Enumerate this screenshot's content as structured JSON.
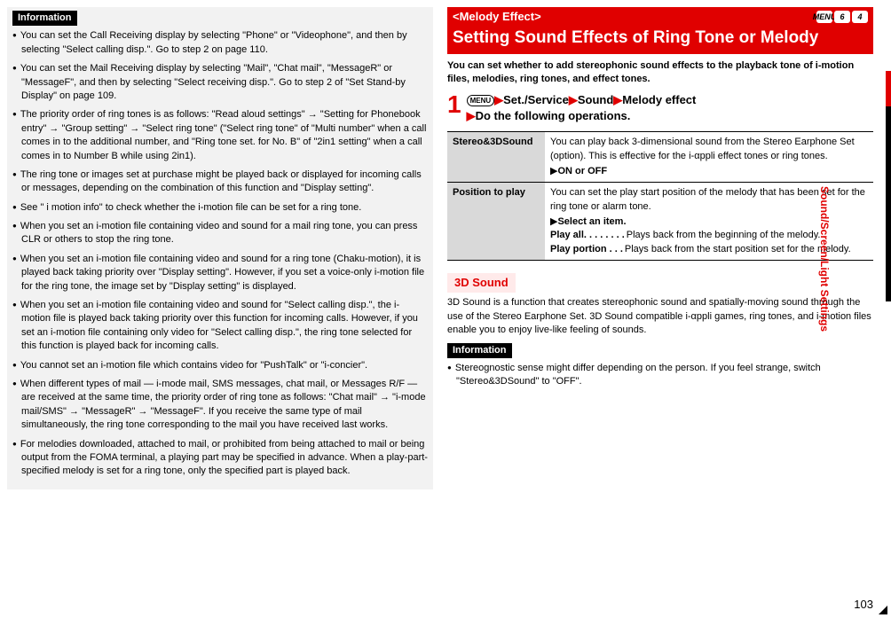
{
  "left": {
    "info_header": "Information",
    "bullets": [
      "You can set the Call Receiving display by selecting \"Phone\" or \"Videophone\", and then by selecting \"Select calling disp.\". Go to step 2 on page 110.",
      "You can set the Mail Receiving display by selecting \"Mail\", \"Chat mail\", \"MessageR\" or \"MessageF\", and then by selecting \"Select receiving disp.\". Go to step 2 of \"Set Stand-by Display\" on page 109.",
      "The priority order of ring tones is as follows: \"Read aloud settings\" → \"Setting for Phonebook entry\" → \"Group setting\" → \"Select ring tone\" (\"Select ring tone\" of \"Multi number\" when a call comes in to the additional number, and \"Ring tone set. for No. B\" of \"2in1 setting\" when a call comes in to Number B while using 2in1).",
      "The ring tone or images set at purchase might be played back or displayed for incoming calls or messages, depending on the combination of this function and \"Display setting\".",
      "See \" i motion info\" to check whether the i-motion file can be set for a ring tone.",
      "When you set an i-motion file containing video and sound for a mail ring tone, you can press CLR or others to stop the ring tone.",
      "When you set an i-motion file containing video and sound for a ring tone (Chaku-motion), it is played back taking priority over \"Display setting\". However, if you set a voice-only i-motion file for the ring tone, the image set by \"Display setting\" is displayed.",
      "When you set an i-motion file containing video and sound for \"Select calling disp.\", the i-motion file is played back taking priority over this function for incoming calls. However, if you set an i-motion file containing only video for \"Select calling disp.\", the ring tone selected for this function is played back for incoming calls.",
      "You cannot set an i-motion file which contains video for \"PushTalk\" or \"i-concier\".",
      "When different types of mail — i-mode mail, SMS messages, chat mail, or Messages R/F — are received at the same time, the priority order of ring tone as follows: \"Chat mail\" → \"i-mode mail/SMS\" → \"MessageR\" → \"MessageF\". If you receive the same type of mail simultaneously, the ring tone corresponding to the mail you have received last works.",
      "For melodies downloaded, attached to mail, or prohibited from being attached to mail or being output from the FOMA terminal, a playing part may be specified in advance. When a play-part-specified melody is set for a ring tone, only the specified part is played back."
    ]
  },
  "right": {
    "section_tag": "<Melody Effect>",
    "icons": [
      "MENU",
      "6",
      "4"
    ],
    "section_title": "Setting Sound Effects of Ring Tone or Melody",
    "lead": "You can set whether to add stereophonic sound effects to the playback tone of i-motion files, melodies, ring tones, and effect tones.",
    "step_num": "1",
    "menu_icon": "MENU",
    "step_line1_a": "Set./Service",
    "step_line1_b": "Sound",
    "step_line1_c": "Melody effect",
    "step_line2": "Do the following operations.",
    "table": [
      {
        "label": "Stereo&3DSound",
        "desc": "You can play back 3-dimensional sound from the Stereo Earphone Set (option). This is effective for the i-αppli effect tones or ring tones.",
        "action": "ON or OFF"
      },
      {
        "label": "Position to play",
        "desc": "You can set the play start position of the melody that has been set for the ring tone or alarm tone.",
        "action": "Select an item.",
        "opts": [
          {
            "name": "Play all",
            "dots": ". . . . . . . .",
            "text": "Plays back from the beginning of the melody."
          },
          {
            "name": "Play portion",
            "dots": " . . .",
            "text": "Plays back from the start position set for the melody."
          }
        ]
      }
    ],
    "sub_heading": "3D Sound",
    "sub_body": "3D Sound is a function that creates stereophonic sound and spatially-moving sound through the use of the Stereo Earphone Set. 3D Sound compatible i-αppli games, ring tones, and i-motion files enable you to enjoy live-like feeling of sounds.",
    "info_header": "Information",
    "info_bullet": "Stereognostic sense might differ depending on the person. If you feel strange, switch \"Stereo&3DSound\" to \"OFF\"."
  },
  "side_tab": "Sound/Screen/Light Settings",
  "page_number": "103"
}
